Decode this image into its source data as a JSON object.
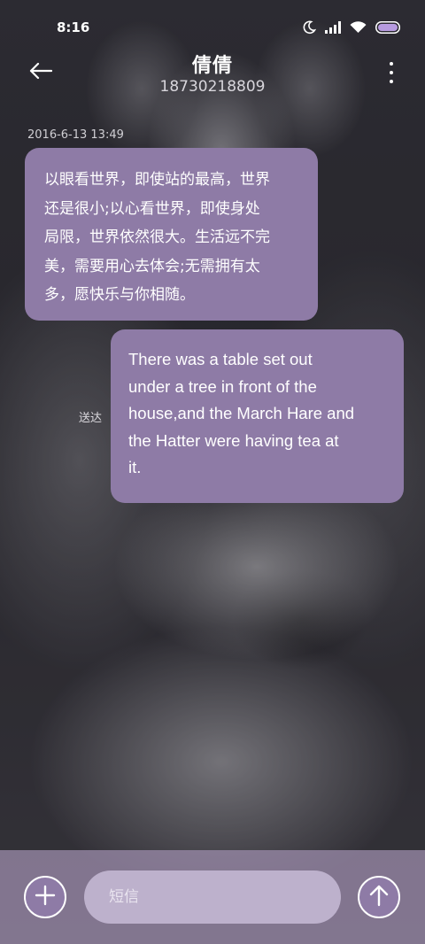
{
  "status_bar": {
    "time": "8:16",
    "icons": [
      "moon-icon",
      "signal-icon",
      "wifi-icon",
      "battery-icon"
    ]
  },
  "header": {
    "contact_name": "倩倩",
    "contact_number": "18730218809",
    "back_icon": "arrow-left-icon",
    "more_icon": "more-vertical-icon"
  },
  "messages": [
    {
      "direction": "incoming",
      "timestamp": "2016-6-13 13:49",
      "lines": [
        "以眼看世界，即使站的最高，世界",
        "还是很小;以心看世界，即使身处",
        "局限，世界依然很大。生活远不完",
        "美，需要用心去体会;无需拥有太",
        "多，愿快乐与你相随。"
      ]
    },
    {
      "direction": "outgoing",
      "status": "送达",
      "lines": [
        "There was a table set out",
        "under a tree in front of the",
        "house,and the March Hare and",
        "the Hatter were having tea at",
        "it."
      ]
    }
  ],
  "composer": {
    "placeholder": "短信",
    "value": "",
    "add_icon": "plus-icon",
    "send_icon": "arrow-up-icon"
  },
  "colors": {
    "bubble": "#8e7ba6",
    "input_bar": "#9687a5",
    "input_field": "#bdb1cc"
  }
}
